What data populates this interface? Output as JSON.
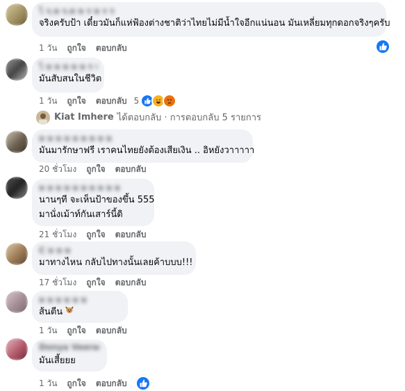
{
  "colors": {
    "bubble": "#f0f2f5",
    "meta": "#65676b",
    "like_blue": "#1877f2",
    "haha": "#f7b125",
    "angry": "#e9710f"
  },
  "comments": [
    {
      "name": "ไ ร.ห ร.ท ห ร ห ร ร",
      "name_blurred": true,
      "text": [
        "จริงครับป้า เดี๋ยวมันก็แห่ฟ้องต่างชาติว่าไทยไม่มีน้ำใจอีกแน่นอน มันเหลี่ยมทุกดอกจริงๆครับ"
      ],
      "time": "1 วัน",
      "like": "ถูกใจ",
      "reply": "ตอบกลับ",
      "avatar_color": "#b0a37a"
    },
    {
      "name": "ไ ห ห ห ห ห ร ห",
      "name_blurred": true,
      "text": [
        "มันสับสนในชีวิต"
      ],
      "time": "1 วัน",
      "like": "ถูกใจ",
      "reply": "ตอบกลับ",
      "reaction_count": "5",
      "avatar_color": "#6b6b6b"
    },
    {
      "name": "ห ห ห ห ห ห ห ห ห",
      "name_blurred": true,
      "text": [
        "มันมารักษาฟรี เราคนไทยยังต้องเสียเงิน .. อิหยังวาาาาา"
      ],
      "time": "20 ชั่วโมง",
      "like": "ถูกใจ",
      "reply": "ตอบกลับ",
      "avatar_color": "#8a7f6f"
    },
    {
      "name": "ห ห ห ห ห ห ห ห ห ห",
      "name_blurred": true,
      "text": [
        "นานๆที จะเห็นป้าของขึ้น 555",
        "มานั่งเม้าท์กันเสาร์นี้ดิ"
      ],
      "time": "21 ชั่วโมง",
      "like": "ถูกใจ",
      "reply": "ตอบกลับ",
      "avatar_color": "#5a5a5a"
    },
    {
      "name": "C ห ห ห",
      "name_blurred": true,
      "text": [
        "มาทางไหน กลับไปทางนั้นเลยค้าบบบ!!!"
      ],
      "time": "17 ชั่วโมง",
      "like": "ถูกใจ",
      "reply": "ตอบกลับ",
      "avatar_color": "#a0876a"
    },
    {
      "name": "ห ห ห ห ห ห",
      "name_blurred": true,
      "text": [
        "ส้นตีน"
      ],
      "time": "1 วัน",
      "like": "ถูกใจ",
      "reply": "ตอบกลับ",
      "avatar_color": "#b8a3a8"
    },
    {
      "name": "Donya Veerasilpa",
      "name_blurred": true,
      "text": [
        "มันเสี้ยยย"
      ],
      "time": "1 วัน",
      "like": "ถูกใจ",
      "reply": "ตอบกลับ",
      "avatar_color": "#b35a6a"
    }
  ],
  "reply_thread": {
    "name": "Kiat Imhere",
    "text": "ได้ตอบกลับ · การตอบกลับ 5 รายการ"
  },
  "icons": {
    "like_badge": "thumbs-up-icon",
    "reactions": [
      "like-icon",
      "haha-icon",
      "angry-icon"
    ],
    "emoji": "dog-face-emoji"
  }
}
